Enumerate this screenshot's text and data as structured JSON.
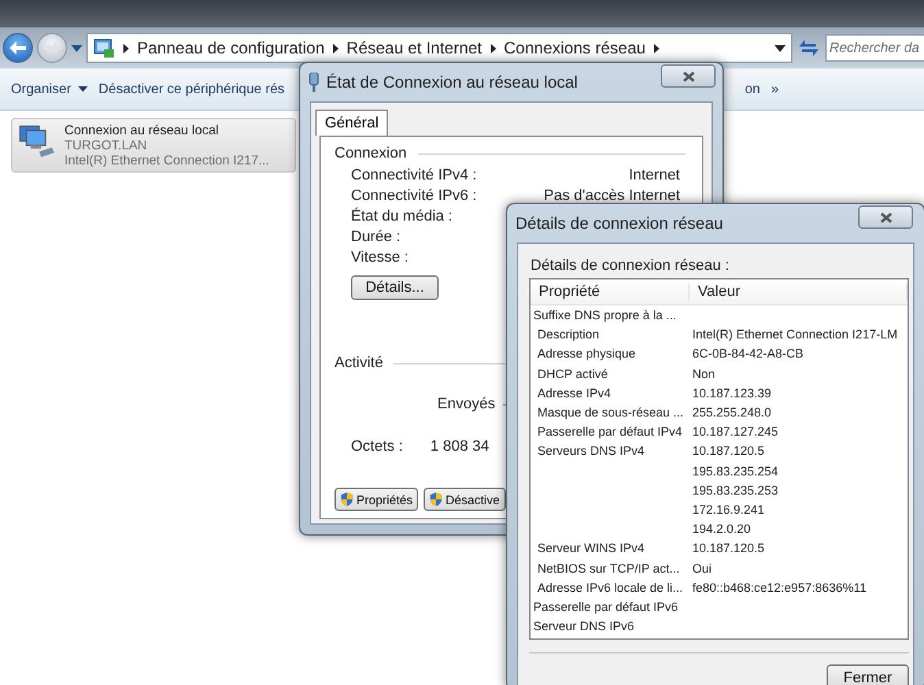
{
  "explorer": {
    "breadcrumb": [
      "Panneau de configuration",
      "Réseau et Internet",
      "Connexions réseau"
    ],
    "search": {
      "placeholder": "Rechercher da"
    },
    "toolbar": [
      {
        "kind": "menu",
        "label": "Organiser"
      },
      {
        "kind": "action",
        "label": "Désactiver ce périphérique rés"
      },
      {
        "kind": "action",
        "label": "on"
      },
      {
        "kind": "more",
        "label": "»"
      }
    ],
    "item": {
      "name": "Connexion au réseau local",
      "domain": "TURGOT.LAN",
      "adapter": "Intel(R) Ethernet Connection I217...",
      "selected": true
    }
  },
  "status_window": {
    "title": "État de Connexion au réseau local",
    "tabs": [
      {
        "label": "Général",
        "selected": true
      }
    ],
    "connection": {
      "heading": "Connexion",
      "rows": [
        {
          "label": "Connectivité IPv4 :",
          "value": "Internet"
        },
        {
          "label": "Connectivité IPv6 :",
          "value": "Pas d'accès Internet"
        },
        {
          "label": "État du média :"
        },
        {
          "label": "Durée :"
        },
        {
          "label": "Vitesse :"
        }
      ],
      "details_button": "Détails..."
    },
    "activity": {
      "heading": "Activité",
      "sent": "Envoyés",
      "bytes_label": "Octets :",
      "bytes_sent": "1 808 34"
    },
    "buttons": [
      "Propriétés",
      "Désactive"
    ]
  },
  "details_window": {
    "title": "Détails de connexion réseau",
    "caption": "Détails de connexion réseau :",
    "columns": [
      "Propriété",
      "Valeur"
    ],
    "rows": [
      {
        "property": "Suffixe DNS propre à la ..."
      },
      {
        "property": "Description",
        "value": "Intel(R) Ethernet Connection I217-LM"
      },
      {
        "property": "Adresse physique",
        "value": "6C-0B-84-42-A8-CB"
      },
      {
        "property": "DHCP activé",
        "value": "Non"
      },
      {
        "property": "Adresse IPv4",
        "value": "10.187.123.39"
      },
      {
        "property": "Masque de sous-réseau ...",
        "value": "255.255.248.0"
      },
      {
        "property": "Passerelle par défaut IPv4",
        "value": "10.187.127.245"
      },
      {
        "property": "Serveurs DNS IPv4",
        "value": "10.187.120.5"
      },
      {
        "value": "195.83.235.254"
      },
      {
        "value": "195.83.235.253"
      },
      {
        "value": "172.16.9.241"
      },
      {
        "value": "194.2.0.20"
      },
      {
        "property": "Serveur WINS IPv4",
        "value": "10.187.120.5"
      },
      {
        "property": "NetBIOS sur TCP/IP act...",
        "value": "Oui"
      },
      {
        "property": "Adresse IPv6 locale de li...",
        "value": "fe80::b468:ce12:e957:8636%11"
      },
      {
        "property": "Passerelle par défaut IPv6"
      },
      {
        "property": "Serveur DNS IPv6"
      }
    ],
    "close_button": "Fermer"
  }
}
